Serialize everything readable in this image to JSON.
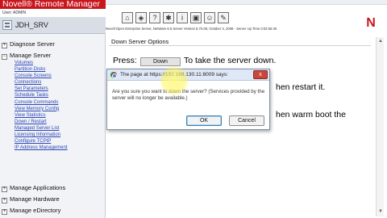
{
  "header": {
    "brand": "Novell® Remote Manager",
    "user": "User: ADMIN",
    "server_name": "JDH_SRV",
    "info_line": "Novell Open Enterprise Server, NetWare 6.5 Server Version 5.70.08, October 3, 2008 - Server Up Time 0:02:56:40",
    "logo": "N",
    "toolbar_icons": [
      "home-icon",
      "shield-icon",
      "help-icon",
      "settings-icon",
      "info-icon",
      "disk-icon",
      "group-icon",
      "tools-icon"
    ]
  },
  "nav": {
    "sections": {
      "diagnose": "Diagnose Server",
      "manage_server": "Manage Server",
      "manage_apps": "Manage Applications",
      "manage_hardware": "Manage Hardware",
      "manage_edir": "Manage eDirectory"
    },
    "links": [
      "Volumes",
      "Partition Disks",
      "Console Screens",
      "Connections",
      "Set Parameters",
      "Schedule Tasks",
      "Console Commands",
      "View Memory Config",
      "View Statistics",
      "Down / Restart",
      "Managed Server List",
      "Licensing Information",
      "Configure TCPIP",
      "IP Address Management"
    ]
  },
  "content": {
    "title": "Down Server Options",
    "press_label": "Press:",
    "down_button": "Down",
    "down_desc": "To take the server down.",
    "restart_fragment": "hen restart it.",
    "warm_fragment": "hen warm boot the"
  },
  "dialog": {
    "title": "The page at https://192.168.130.11:8009 says:",
    "message": "Are you sure you want to down the server? (Services provided by the server will no longer be available.)",
    "ok": "OK",
    "cancel": "Cancel",
    "close": "x"
  }
}
